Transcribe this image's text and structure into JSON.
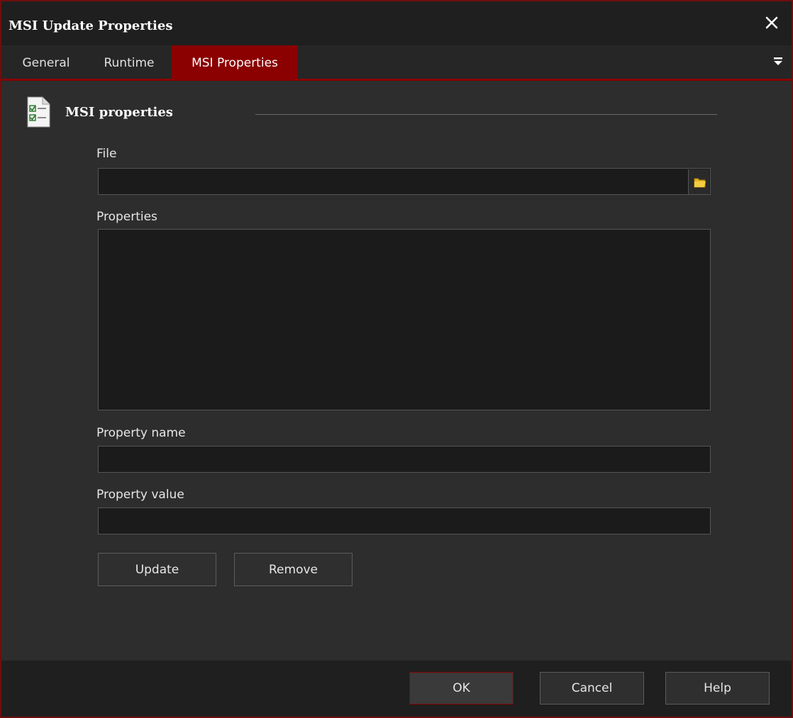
{
  "window": {
    "title": "MSI Update Properties",
    "close_icon": "close-icon",
    "accent_color": "#8b0000",
    "border_color": "#6e0e0e"
  },
  "tabs": [
    {
      "label": "General",
      "active": false
    },
    {
      "label": "Runtime",
      "active": false
    },
    {
      "label": "MSI Properties",
      "active": true
    }
  ],
  "tab_menu_icon": "dropdown-menu-icon",
  "section": {
    "title": "MSI properties",
    "icon": "checklist-document-icon"
  },
  "form": {
    "file_label": "File",
    "file_value": "",
    "browse_icon": "folder-icon",
    "properties_label": "Properties",
    "properties_value": "",
    "property_name_label": "Property name",
    "property_name_value": "",
    "property_value_label": "Property value",
    "property_value_value": ""
  },
  "actions": {
    "update_label": "Update",
    "remove_label": "Remove"
  },
  "footer": {
    "ok_label": "OK",
    "cancel_label": "Cancel",
    "help_label": "Help"
  }
}
